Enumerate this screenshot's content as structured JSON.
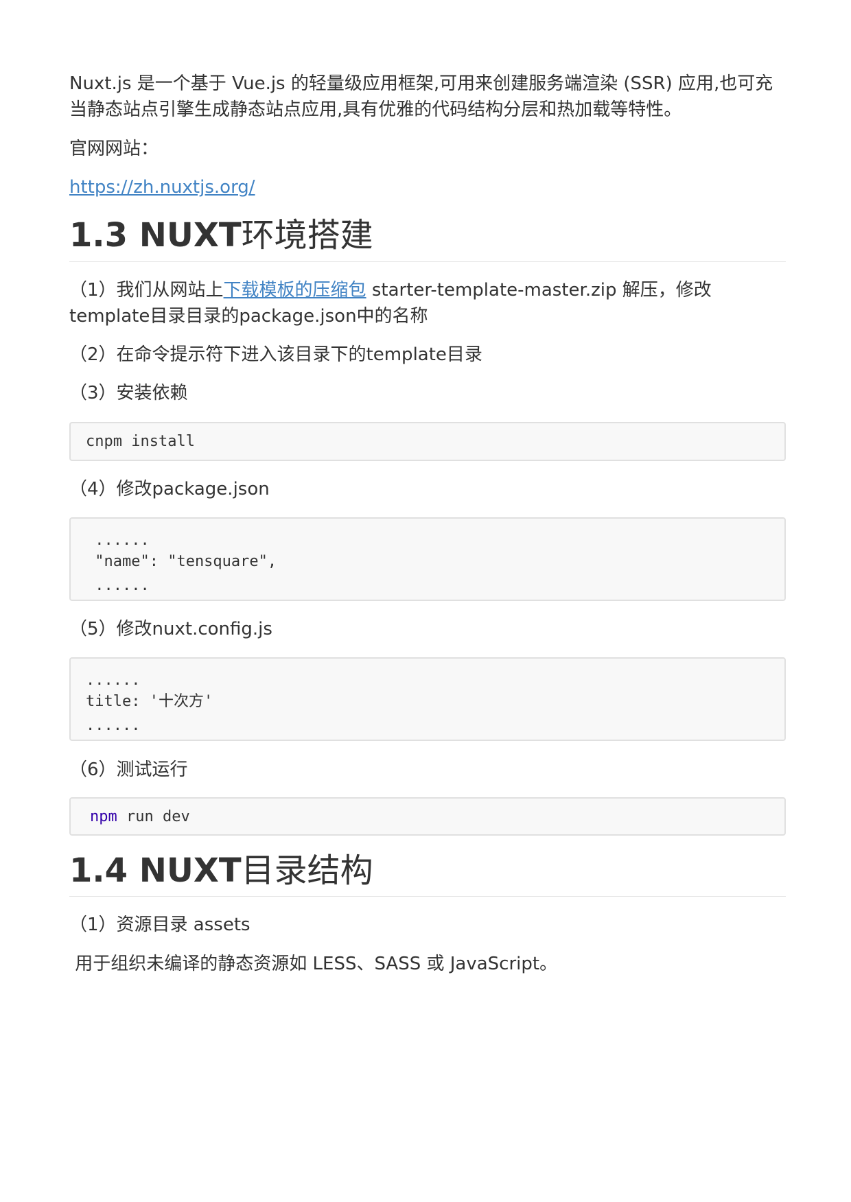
{
  "intro": {
    "line1": "Nuxt.js 是一个基于 Vue.js 的轻量级应用框架,可用来创建服务端渲染 (SSR) 应用,也可充",
    "line2": "当静态站点引擎生成静态站点应用,具有优雅的代码结构分层和热加载等特性。",
    "site_label": "官网网站：",
    "site_url": "https://zh.nuxtjs.org/"
  },
  "section13": {
    "number": "1.3 NUXT",
    "title": "环境搭建",
    "step1_prefix": "（1）我们从网站上",
    "step1_link": "下载模板的压缩包",
    "step1_suffix": " starter-template-master.zip 解压，修改",
    "step1_line2": "template目录目录的package.json中的名称",
    "step2": "（2）在命令提示符下进入该目录下的template目录",
    "step3": "（3）安装依赖",
    "code1": "cnpm install",
    "step4": "（4）修改package.json",
    "code2": [
      " ......",
      " \"name\": \"tensquare\",",
      " ......"
    ],
    "step5": "（5）修改nuxt.config.js",
    "code3": [
      "......",
      "title: '十次方'",
      "......"
    ],
    "step6": "（6）测试运行",
    "code4_kw": "npm",
    "code4_rest": " run dev"
  },
  "section14": {
    "number": "1.4 NUXT",
    "title": "目录结构",
    "step1": "（1）资源目录 assets",
    "desc": " 用于组织未编译的静态资源如 LESS、SASS 或 JavaScript。"
  },
  "colors": {
    "text": "#333333",
    "link": "#4183c4",
    "code_bg": "#f8f8f8",
    "code_border": "#e0e0e0",
    "keyword": "#3300aa"
  }
}
